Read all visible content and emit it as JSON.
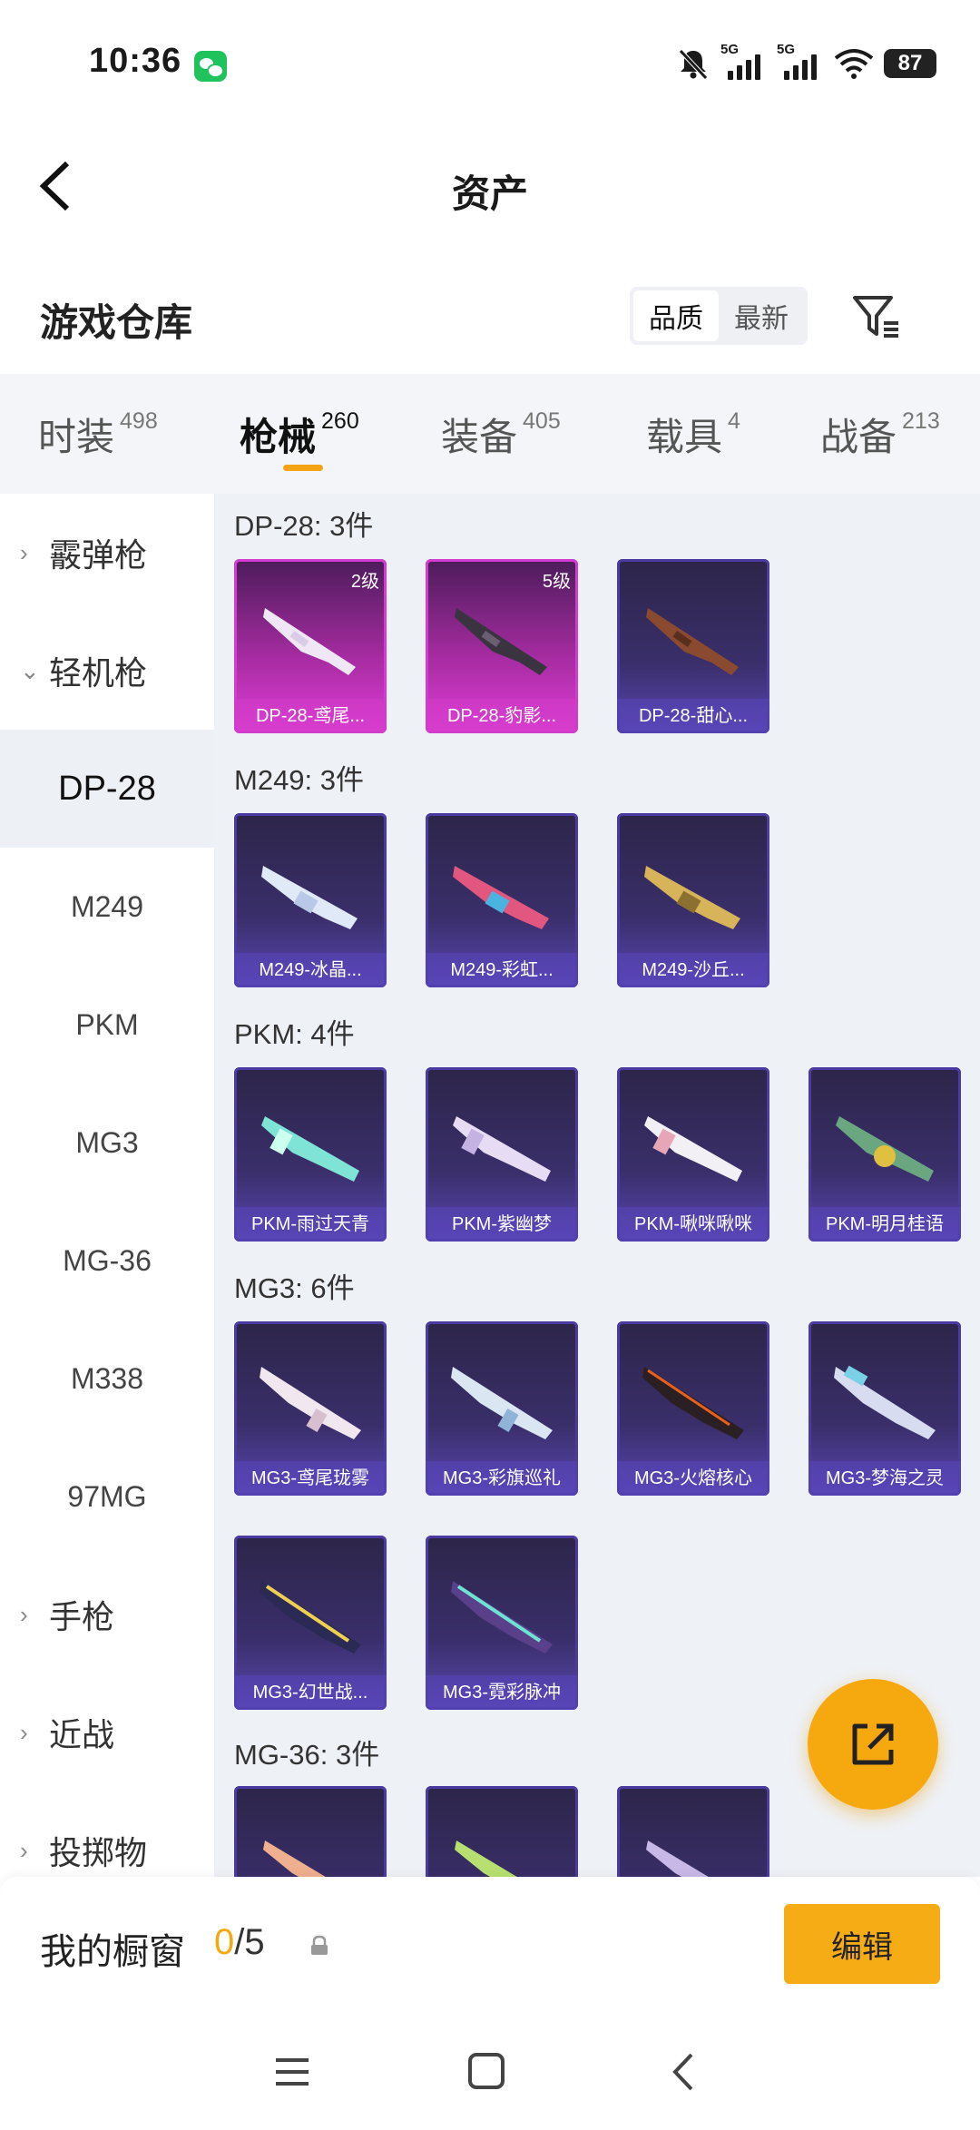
{
  "status_bar": {
    "time": "10:36",
    "net1": "5G",
    "net2": "5G",
    "battery": "87"
  },
  "header": {
    "title": "资产"
  },
  "section": {
    "title": "游戏仓库",
    "sort_options": [
      "品质",
      "最新"
    ]
  },
  "tabs": [
    {
      "label": "时装",
      "count": "498"
    },
    {
      "label": "枪械",
      "count": "260"
    },
    {
      "label": "装备",
      "count": "405"
    },
    {
      "label": "载具",
      "count": "4"
    },
    {
      "label": "战备",
      "count": "213"
    }
  ],
  "sidebar": {
    "items": [
      {
        "label": "霰弹枪"
      },
      {
        "label": "轻机枪"
      },
      {
        "label": "DP-28"
      },
      {
        "label": "M249"
      },
      {
        "label": "PKM"
      },
      {
        "label": "MG3"
      },
      {
        "label": "MG-36"
      },
      {
        "label": "M338"
      },
      {
        "label": "97MG"
      },
      {
        "label": "手枪"
      },
      {
        "label": "近战"
      },
      {
        "label": "投掷物"
      }
    ]
  },
  "groups": [
    {
      "title": "DP-28: 3件",
      "items": [
        {
          "name": "DP-28-鸢尾...",
          "level": "2级"
        },
        {
          "name": "DP-28-豹影...",
          "level": "5级"
        },
        {
          "name": "DP-28-甜心..."
        }
      ]
    },
    {
      "title": "M249: 3件",
      "items": [
        {
          "name": "M249-冰晶..."
        },
        {
          "name": "M249-彩虹..."
        },
        {
          "name": "M249-沙丘..."
        }
      ]
    },
    {
      "title": "PKM: 4件",
      "items": [
        {
          "name": "PKM-雨过天青"
        },
        {
          "name": "PKM-紫幽梦"
        },
        {
          "name": "PKM-啾咪啾咪"
        },
        {
          "name": "PKM-明月桂语"
        }
      ]
    },
    {
      "title": "MG3: 6件",
      "items": [
        {
          "name": "MG3-鸢尾珑雾"
        },
        {
          "name": "MG3-彩旗巡礼"
        },
        {
          "name": "MG3-火熔核心"
        },
        {
          "name": "MG3-梦海之灵"
        },
        {
          "name": "MG3-幻世战..."
        },
        {
          "name": "MG3-霓彩脉冲"
        }
      ]
    },
    {
      "title": "MG-36: 3件",
      "items": [
        {
          "name": ""
        },
        {
          "name": ""
        },
        {
          "name": ""
        }
      ]
    }
  ],
  "showcase": {
    "label": "我的橱窗",
    "current": "0",
    "total": "/5",
    "edit_label": "编辑"
  },
  "colors": {
    "accent": "#f6a80f",
    "card_purple": "#3a2f6b",
    "card_pink": "#d33cd0"
  }
}
